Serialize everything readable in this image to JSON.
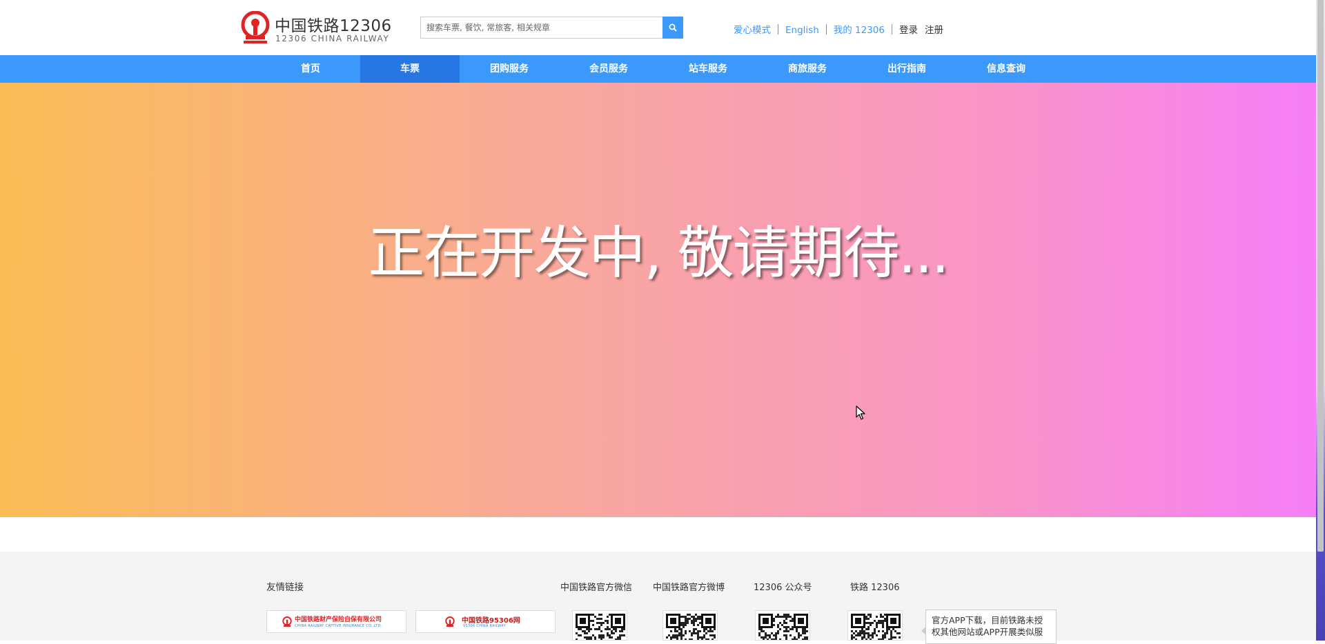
{
  "header": {
    "logo_cn": "中国铁路12306",
    "logo_en": "12306 CHINA RAILWAY",
    "search_placeholder": "搜索车票, 餐饮, 常旅客, 相关规章",
    "links": {
      "care_mode": "爱心模式",
      "english": "English",
      "my12306": "我的 12306",
      "login": "登录",
      "register": "注册"
    }
  },
  "nav": {
    "items": [
      "首页",
      "车票",
      "团购服务",
      "会员服务",
      "站车服务",
      "商旅服务",
      "出行指南",
      "信息查询"
    ],
    "active": "车票"
  },
  "hero": {
    "message": "正在开发中, 敬请期待..."
  },
  "footer": {
    "friend_links_title": "友情链接",
    "partners": [
      {
        "name": "中国铁路财产保险自保有限公司",
        "sub": "CHINA RAILWAY CAPTIVE INSURANCE CO.,LTD."
      },
      {
        "name": "中国铁路95306网",
        "sub": "95306 CHINA RAILWAY"
      }
    ],
    "qr_titles": [
      "中国铁路官方微信",
      "中国铁路官方微博",
      "12306 公众号",
      "铁路 12306"
    ],
    "app_note": "官方APP下载，目前铁路未授权其他网站或APP开展类似服"
  },
  "colors": {
    "brand_blue": "#3b99fc",
    "nav_active": "#2676e3",
    "logo_red": "#e02323",
    "hero_gradient": [
      "#fbbc55",
      "#f9a7a0",
      "#f995c6",
      "#f67ef8"
    ]
  },
  "icons": [
    "railway-logo-icon",
    "search-icon",
    "qr-code-icon",
    "mouse-cursor-icon"
  ]
}
